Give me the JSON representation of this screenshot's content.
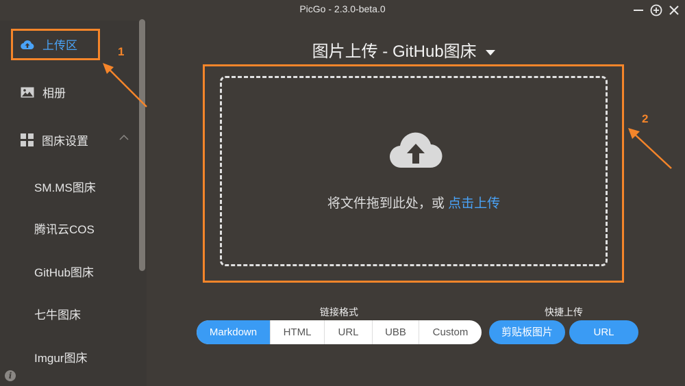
{
  "window": {
    "title": "PicGo - 2.3.0-beta.0"
  },
  "sidebar": {
    "items": [
      {
        "label": "上传区",
        "icon": "upload-cloud-icon",
        "active": true
      },
      {
        "label": "相册",
        "icon": "picture-icon"
      },
      {
        "label": "图床设置",
        "icon": "grid-menu-icon"
      }
    ],
    "sub_items": [
      "SM.MS图床",
      "腾讯云COS",
      "GitHub图床",
      "七牛图床",
      "Imgur图床"
    ],
    "info_glyph": "i"
  },
  "annotations": {
    "num1": "1",
    "num2": "2",
    "color": "#f5852a"
  },
  "main": {
    "title": "图片上传 - GitHub图床",
    "drop_text": "将文件拖到此处，或 ",
    "drop_link": "点击上传"
  },
  "link_format": {
    "label": "链接格式",
    "options": [
      "Markdown",
      "HTML",
      "URL",
      "UBB",
      "Custom"
    ],
    "selected": "Markdown"
  },
  "quick_upload": {
    "label": "快捷上传",
    "buttons": [
      "剪贴板图片",
      "URL"
    ]
  },
  "colors": {
    "accent": "#3a9bf4",
    "background": "#3f3b37"
  }
}
